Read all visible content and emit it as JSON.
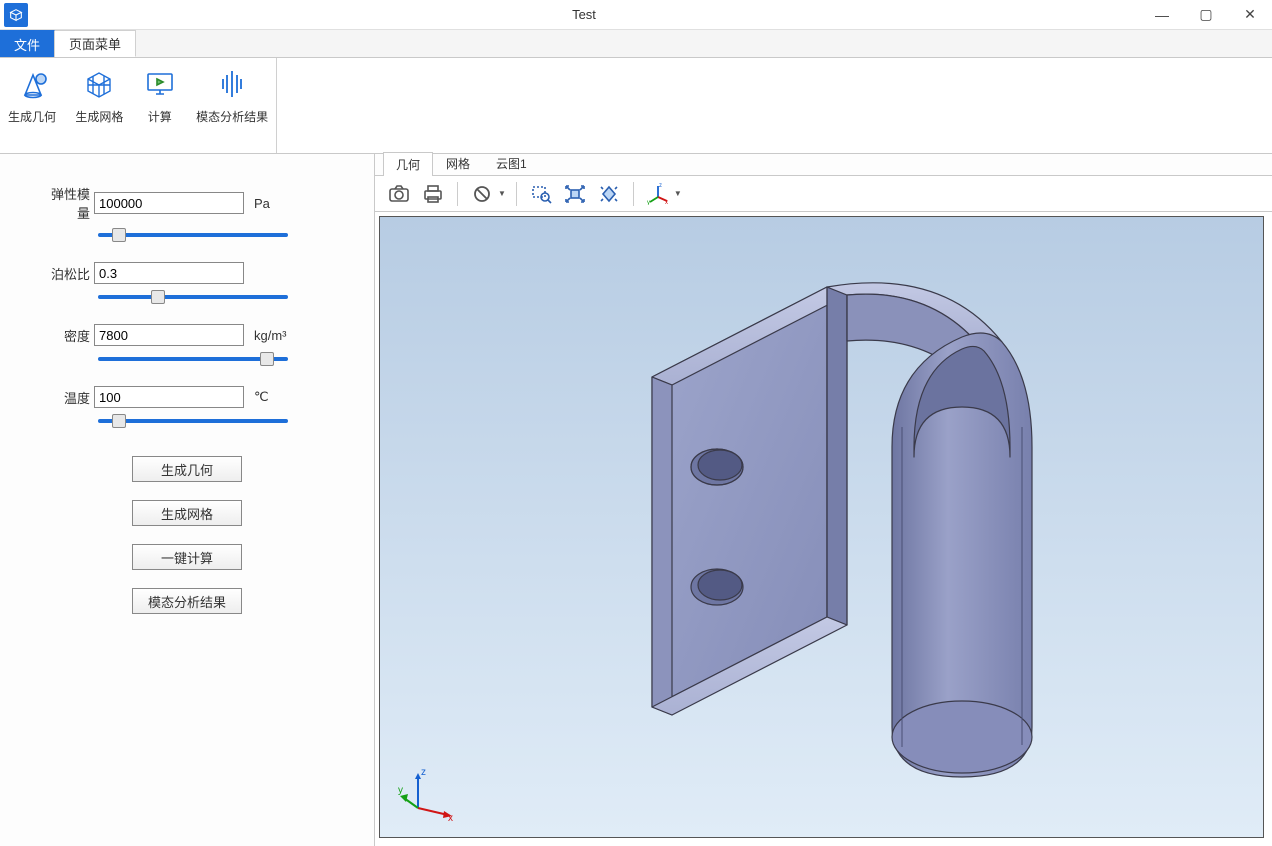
{
  "window": {
    "title": "Test"
  },
  "menuTabs": {
    "file": "文件",
    "page": "页面菜单"
  },
  "ribbon": {
    "items": [
      {
        "label": "生成几何"
      },
      {
        "label": "生成网格"
      },
      {
        "label": "计算"
      },
      {
        "label": "模态分析结果"
      }
    ]
  },
  "form": {
    "elastic": {
      "label": "弹性模量",
      "value": "100000",
      "unit": "Pa"
    },
    "poisson": {
      "label": "泊松比",
      "value": "0.3",
      "unit": ""
    },
    "density": {
      "label": "密度",
      "value": "7800",
      "unit": "kg/m³"
    },
    "temperature": {
      "label": "温度",
      "value": "100",
      "unit": "℃"
    }
  },
  "buttons": {
    "genGeom": "生成几何",
    "genMesh": "生成网格",
    "compute": "一键计算",
    "modal": "模态分析结果"
  },
  "viewTabs": {
    "geom": "几何",
    "mesh": "网格",
    "cloud": "云图1"
  },
  "iconNames": {
    "camera": "camera-icon",
    "print": "print-icon",
    "forbid": "forbid-icon",
    "zoomrect": "zoom-rect-icon",
    "fit": "fit-view-icon",
    "rotate": "rotate-view-icon",
    "axes": "axes-icon"
  }
}
